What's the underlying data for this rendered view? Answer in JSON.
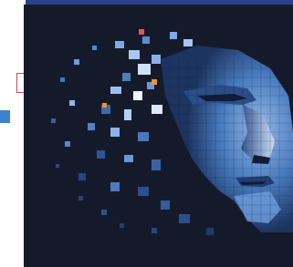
{
  "hero": {
    "background_color": "#151a2b",
    "accent_color": "#4d8fd9",
    "highlight_color": "#d9e6ff",
    "spark_colors": [
      "#e0594c",
      "#e6953a"
    ],
    "depiction": "pixelated-face"
  },
  "left_controls": {
    "marker_color": "#c94a4a",
    "square_color": "#3a83cf"
  },
  "top_bar": {
    "color": "#2b3f8c"
  }
}
